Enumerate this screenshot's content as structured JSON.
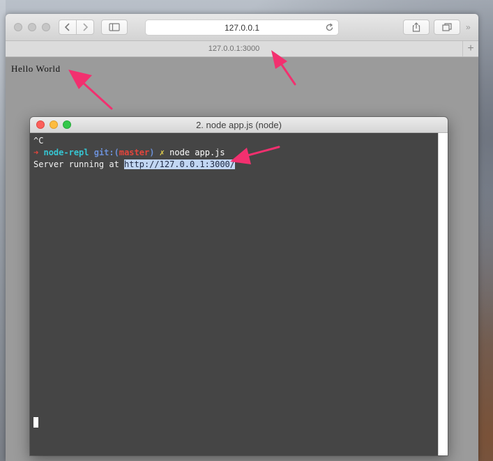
{
  "browser": {
    "address": "127.0.0.1",
    "tab_title": "127.0.0.1:3000",
    "new_tab_label": "+",
    "content_text": "Hello World"
  },
  "terminal": {
    "title": "2. node app.js (node)",
    "lines": {
      "interrupt": "^C",
      "prompt_arrow": "➜",
      "prompt_dir": "node-repl",
      "prompt_git_prefix": "git:(",
      "prompt_branch": "master",
      "prompt_git_suffix": ")",
      "prompt_dirty": "✗",
      "command": "node app.js",
      "server_text": "Server running at ",
      "server_url": "http://127.0.0.1:3000/"
    }
  },
  "colors": {
    "annotation_arrow": "#f2306f",
    "terminal_bg": "#454545",
    "selection": "#c2d6f3"
  },
  "icons": [
    "back-icon",
    "forward-icon",
    "sidebar-icon",
    "reload-icon",
    "share-icon",
    "tabs-overview-icon",
    "more-icon",
    "plus-icon"
  ]
}
